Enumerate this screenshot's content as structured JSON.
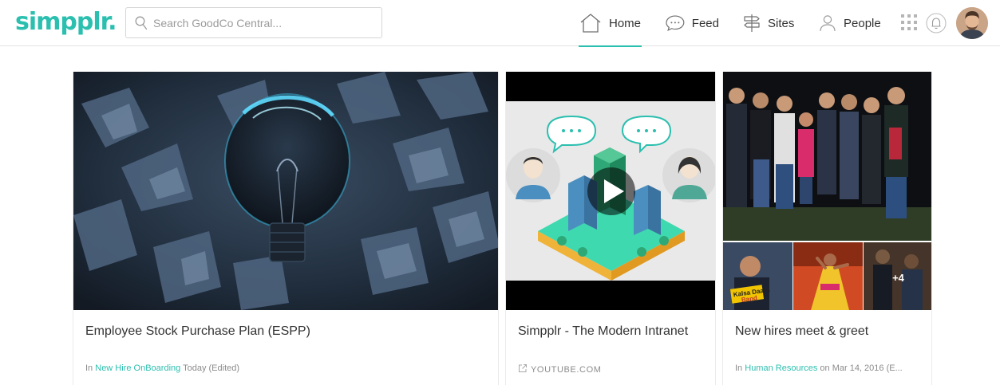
{
  "app": {
    "logo": "simpplr.",
    "brand_color": "#2bbfaf"
  },
  "search": {
    "placeholder": "Search GoodCo Central..."
  },
  "nav": {
    "items": [
      {
        "label": "Home",
        "icon": "home-icon",
        "active": true
      },
      {
        "label": "Feed",
        "icon": "feed-icon",
        "active": false
      },
      {
        "label": "Sites",
        "icon": "sites-icon",
        "active": false
      },
      {
        "label": "People",
        "icon": "people-icon",
        "active": false
      }
    ],
    "utilities": [
      "apps-grid-icon",
      "bell-icon",
      "avatar"
    ]
  },
  "cards": [
    {
      "title": "Employee Stock Purchase Plan (ESPP)",
      "meta_prefix": "In",
      "meta_link": "New Hire OnBoarding",
      "meta_suffix": "Today (Edited)"
    },
    {
      "title": "Simpplr - The Modern Intranet",
      "source": "YOUTUBE.COM"
    },
    {
      "title": "New hires meet & greet",
      "meta_prefix": "In",
      "meta_link": "Human Resources",
      "meta_suffix": "on Mar 14, 2016 (E...",
      "more_photos": "+4",
      "sign_text_1": "Kalsa Daaru",
      "sign_text_2": "Band"
    }
  ]
}
